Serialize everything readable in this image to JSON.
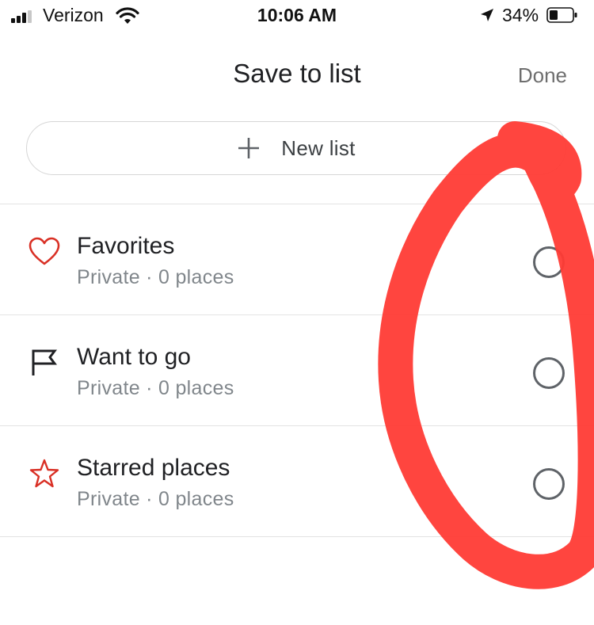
{
  "status_bar": {
    "carrier": "Verizon",
    "time": "10:06 AM",
    "battery_percent": "34%",
    "signal_icon": "signal-bars-icon",
    "wifi_icon": "wifi-icon",
    "location_icon": "location-arrow-icon",
    "battery_icon": "battery-icon"
  },
  "header": {
    "title": "Save to list",
    "done_label": "Done"
  },
  "new_list": {
    "label": "New list",
    "icon": "plus-icon"
  },
  "lists": [
    {
      "title": "Favorites",
      "subtitle": "Private · 0 places",
      "icon": "heart-icon",
      "selected": false
    },
    {
      "title": "Want to go",
      "subtitle": "Private · 0 places",
      "icon": "flag-icon",
      "selected": false
    },
    {
      "title": "Starred places",
      "subtitle": "Private · 0 places",
      "icon": "star-icon",
      "selected": false
    }
  ],
  "colors": {
    "icon_red": "#d93025",
    "annotation_red": "#ff3b35",
    "radio_gray": "#5f6368",
    "subtitle_gray": "#80868b"
  }
}
